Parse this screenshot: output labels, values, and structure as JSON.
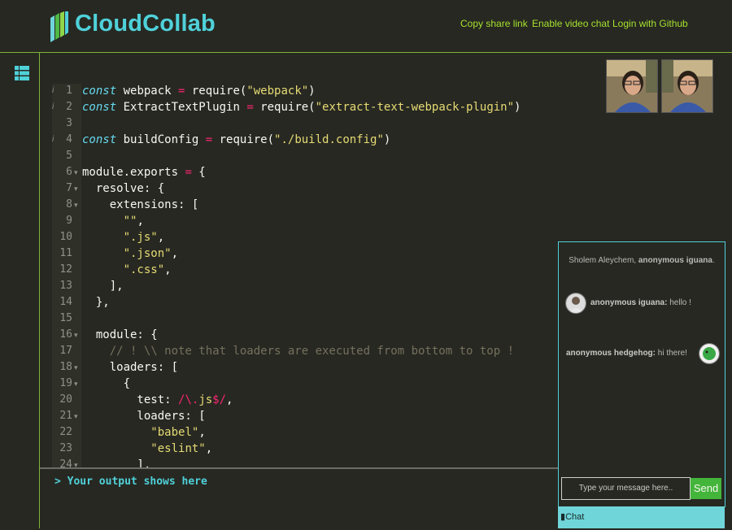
{
  "header": {
    "brand": "CloudCollab",
    "nav": [
      {
        "label": "Copy share link"
      },
      {
        "label": "Enable video chat"
      },
      {
        "label": "Login with Github"
      }
    ]
  },
  "colors": {
    "accent_cyan": "#4fd1d9",
    "accent_green": "#a6e22e",
    "border_green": "#7fb339",
    "editor_bg": "#272822",
    "send_green": "#44b53b",
    "chat_tab": "#6fd5d9"
  },
  "editor": {
    "lines": [
      {
        "n": "1",
        "warn": true,
        "fold": false,
        "tokens": [
          [
            "kw",
            "const"
          ],
          [
            "fn",
            " webpack "
          ],
          [
            "op",
            "="
          ],
          [
            "fn",
            " require("
          ],
          [
            "str",
            "\"webpack\""
          ],
          [
            "fn",
            ")"
          ]
        ]
      },
      {
        "n": "2",
        "warn": true,
        "fold": false,
        "tokens": [
          [
            "kw",
            "const"
          ],
          [
            "fn",
            " ExtractTextPlugin "
          ],
          [
            "op",
            "="
          ],
          [
            "fn",
            " require("
          ],
          [
            "str",
            "\"extract-text-webpack-plugin\""
          ],
          [
            "fn",
            ")"
          ]
        ]
      },
      {
        "n": "3",
        "warn": false,
        "fold": false,
        "tokens": []
      },
      {
        "n": "4",
        "warn": true,
        "fold": false,
        "tokens": [
          [
            "kw",
            "const"
          ],
          [
            "fn",
            " buildConfig "
          ],
          [
            "op",
            "="
          ],
          [
            "fn",
            " require("
          ],
          [
            "str",
            "\"./build.config\""
          ],
          [
            "fn",
            ")"
          ]
        ]
      },
      {
        "n": "5",
        "warn": false,
        "fold": false,
        "tokens": []
      },
      {
        "n": "6",
        "warn": false,
        "fold": true,
        "tokens": [
          [
            "fn",
            "module.exports "
          ],
          [
            "op",
            "="
          ],
          [
            "fn",
            " {"
          ]
        ]
      },
      {
        "n": "7",
        "warn": false,
        "fold": true,
        "tokens": [
          [
            "fn",
            "  resolve: {"
          ]
        ]
      },
      {
        "n": "8",
        "warn": false,
        "fold": true,
        "tokens": [
          [
            "fn",
            "    extensions: ["
          ]
        ]
      },
      {
        "n": "9",
        "warn": false,
        "fold": false,
        "tokens": [
          [
            "fn",
            "      "
          ],
          [
            "str",
            "\"\""
          ],
          [
            "fn",
            ","
          ]
        ]
      },
      {
        "n": "10",
        "warn": false,
        "fold": false,
        "tokens": [
          [
            "fn",
            "      "
          ],
          [
            "str",
            "\".js\""
          ],
          [
            "fn",
            ","
          ]
        ]
      },
      {
        "n": "11",
        "warn": false,
        "fold": false,
        "tokens": [
          [
            "fn",
            "      "
          ],
          [
            "str",
            "\".json\""
          ],
          [
            "fn",
            ","
          ]
        ]
      },
      {
        "n": "12",
        "warn": false,
        "fold": false,
        "tokens": [
          [
            "fn",
            "      "
          ],
          [
            "str",
            "\".css\""
          ],
          [
            "fn",
            ","
          ]
        ]
      },
      {
        "n": "13",
        "warn": false,
        "fold": false,
        "tokens": [
          [
            "fn",
            "    ],"
          ]
        ]
      },
      {
        "n": "14",
        "warn": false,
        "fold": false,
        "tokens": [
          [
            "fn",
            "  },"
          ]
        ]
      },
      {
        "n": "15",
        "warn": false,
        "fold": false,
        "tokens": []
      },
      {
        "n": "16",
        "warn": false,
        "fold": true,
        "tokens": [
          [
            "fn",
            "  module: {"
          ]
        ]
      },
      {
        "n": "17",
        "warn": false,
        "fold": false,
        "tokens": [
          [
            "cm",
            "    // ! \\\\ note that loaders are executed from bottom to top !"
          ]
        ]
      },
      {
        "n": "18",
        "warn": false,
        "fold": true,
        "tokens": [
          [
            "fn",
            "    loaders: ["
          ]
        ]
      },
      {
        "n": "19",
        "warn": false,
        "fold": true,
        "tokens": [
          [
            "fn",
            "      {"
          ]
        ]
      },
      {
        "n": "20",
        "warn": false,
        "fold": false,
        "tokens": [
          [
            "fn",
            "        test: "
          ],
          [
            "op",
            "/\\."
          ],
          [
            "str",
            "js"
          ],
          [
            "op",
            "$/"
          ],
          [
            "fn",
            ","
          ]
        ]
      },
      {
        "n": "21",
        "warn": false,
        "fold": true,
        "tokens": [
          [
            "fn",
            "        loaders: ["
          ]
        ]
      },
      {
        "n": "22",
        "warn": false,
        "fold": false,
        "tokens": [
          [
            "fn",
            "          "
          ],
          [
            "str",
            "\"babel\""
          ],
          [
            "fn",
            ","
          ]
        ]
      },
      {
        "n": "23",
        "warn": false,
        "fold": false,
        "tokens": [
          [
            "fn",
            "          "
          ],
          [
            "str",
            "\"eslint\""
          ],
          [
            "fn",
            ","
          ]
        ]
      },
      {
        "n": "24",
        "warn": false,
        "fold": true,
        "tokens": [
          [
            "fn",
            "        ],"
          ]
        ]
      }
    ]
  },
  "output": {
    "text": "> Your output shows here"
  },
  "chat": {
    "greeting_prefix": "Sholem Aleychem, ",
    "greeting_name": "anonymous iguana",
    "greeting_suffix": ".",
    "messages": [
      {
        "user": "anonymous iguana:",
        "text": " hello !"
      },
      {
        "user": "anonymous hedgehog:",
        "text": " hi there!"
      }
    ],
    "input_placeholder": "Type your message here..",
    "send_label": "Send",
    "tab_label": "Chat"
  }
}
